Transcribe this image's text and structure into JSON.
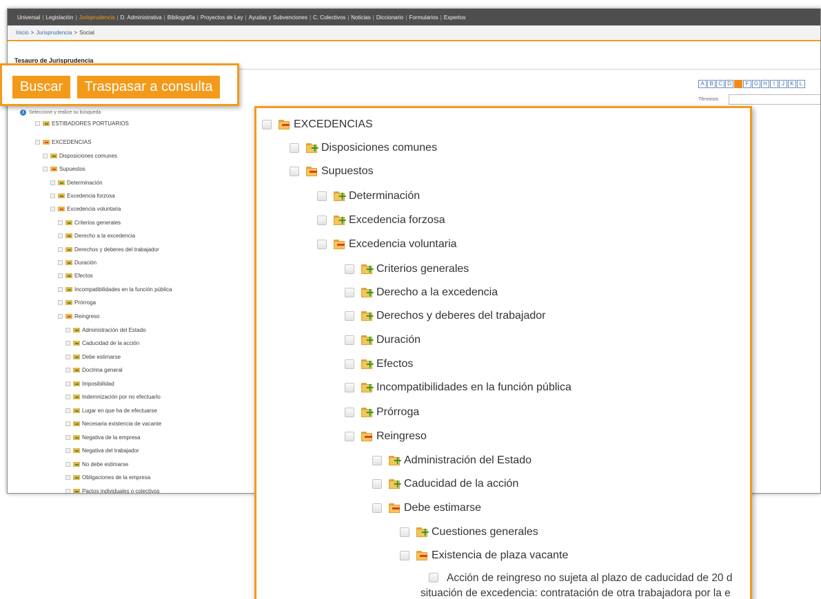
{
  "nav": {
    "items": [
      {
        "label": "Universal",
        "active": false
      },
      {
        "label": "Legislación",
        "active": false
      },
      {
        "label": "Jurisprudencia",
        "active": true
      },
      {
        "label": "D. Administrativa",
        "active": false
      },
      {
        "label": "Bibliografía",
        "active": false
      },
      {
        "label": "Proyectos de Ley",
        "active": false
      },
      {
        "label": "Ayudas y Subvenciones",
        "active": false
      },
      {
        "label": "C. Colectivos",
        "active": false
      },
      {
        "label": "Noticias",
        "active": false
      },
      {
        "label": "Diccionario",
        "active": false
      },
      {
        "label": "Formularios",
        "active": false
      },
      {
        "label": "Expertos",
        "active": false
      }
    ]
  },
  "breadcrumb": {
    "items": [
      "Inicio",
      "Jurisprudencia",
      "Social"
    ],
    "separator": ">"
  },
  "page": {
    "title": "Tesauro de Jurisprudencia",
    "hint": "Seleccione y realice su búsqueda",
    "terms_label": "Términos",
    "alphabet": [
      "A",
      "B",
      "C",
      "D",
      "E",
      "F",
      "G",
      "H",
      "I",
      "J",
      "K",
      "L"
    ],
    "active_letter": "E"
  },
  "buttons": {
    "search_label": "Buscar",
    "transfer_label": "Traspasar a consulta"
  },
  "small_tree": [
    {
      "label": "ESTIBADORES PORTUARIOS",
      "state": "closed"
    },
    {
      "label": "EXCEDENCIAS",
      "state": "open"
    },
    {
      "label": "Disposiciones comunes",
      "state": "closed"
    },
    {
      "label": "Supuestos",
      "state": "open"
    },
    {
      "label": "Determinación",
      "state": "closed"
    },
    {
      "label": "Excedencia forzosa",
      "state": "closed"
    },
    {
      "label": "Excedencia voluntaria",
      "state": "open"
    },
    {
      "label": "Criterios generales",
      "state": "closed"
    },
    {
      "label": "Derecho a la excedencia",
      "state": "closed"
    },
    {
      "label": "Derechos y deberes del trabajador",
      "state": "closed"
    },
    {
      "label": "Duración",
      "state": "closed"
    },
    {
      "label": "Efectos",
      "state": "closed"
    },
    {
      "label": "Incompatibilidades en la función pública",
      "state": "closed"
    },
    {
      "label": "Prórroga",
      "state": "closed"
    },
    {
      "label": "Reingreso",
      "state": "open"
    },
    {
      "label": "Administración del Estado",
      "state": "closed"
    },
    {
      "label": "Caducidad de la acción",
      "state": "closed"
    },
    {
      "label": "Debe estimarse",
      "state": "closed"
    },
    {
      "label": "Doctrina general",
      "state": "closed"
    },
    {
      "label": "Imposibilidad",
      "state": "closed"
    },
    {
      "label": "Indemnización por no efectuarlo",
      "state": "closed"
    },
    {
      "label": "Lugar en que ha de efectuarse",
      "state": "closed"
    },
    {
      "label": "Necesaria existencia de vacante",
      "state": "closed"
    },
    {
      "label": "Negativa de la empresa",
      "state": "closed"
    },
    {
      "label": "Negativa del trabajador",
      "state": "closed"
    },
    {
      "label": "No debe estimarse",
      "state": "closed"
    },
    {
      "label": "Obligaciones de la empresa",
      "state": "closed"
    },
    {
      "label": "Pactos individuales o colectivos",
      "state": "closed"
    }
  ],
  "tree": [
    {
      "label": "EXCEDENCIAS",
      "state": "open"
    },
    {
      "label": "Disposiciones comunes",
      "state": "closed"
    },
    {
      "label": "Supuestos",
      "state": "open"
    },
    {
      "label": "Determinación",
      "state": "closed"
    },
    {
      "label": "Excedencia forzosa",
      "state": "closed"
    },
    {
      "label": "Excedencia voluntaria",
      "state": "open"
    },
    {
      "label": "Criterios generales",
      "state": "closed"
    },
    {
      "label": "Derecho a la excedencia",
      "state": "closed"
    },
    {
      "label": "Derechos y deberes del trabajador",
      "state": "closed"
    },
    {
      "label": "Duración",
      "state": "closed"
    },
    {
      "label": "Efectos",
      "state": "closed"
    },
    {
      "label": "Incompatibilidades en la función pública",
      "state": "closed"
    },
    {
      "label": "Prórroga",
      "state": "closed"
    },
    {
      "label": "Reingreso",
      "state": "open"
    },
    {
      "label": "Administración del Estado",
      "state": "closed"
    },
    {
      "label": "Caducidad de la acción",
      "state": "closed"
    },
    {
      "label": "Debe estimarse",
      "state": "open"
    },
    {
      "label": "Cuestiones generales",
      "state": "closed"
    },
    {
      "label": "Existencia de plaza vacante",
      "state": "open"
    }
  ],
  "document": {
    "line1": "Acción de reingreso no sujeta al plazo de caducidad de 20 d",
    "line2": "situación de excedencia: contratación de otra trabajadora por la e"
  },
  "colors": {
    "accent": "#f39a1a",
    "nav_bg": "#4e4e4e",
    "plus_green": "#1f9a2c",
    "minus_red": "#e23c1f"
  }
}
